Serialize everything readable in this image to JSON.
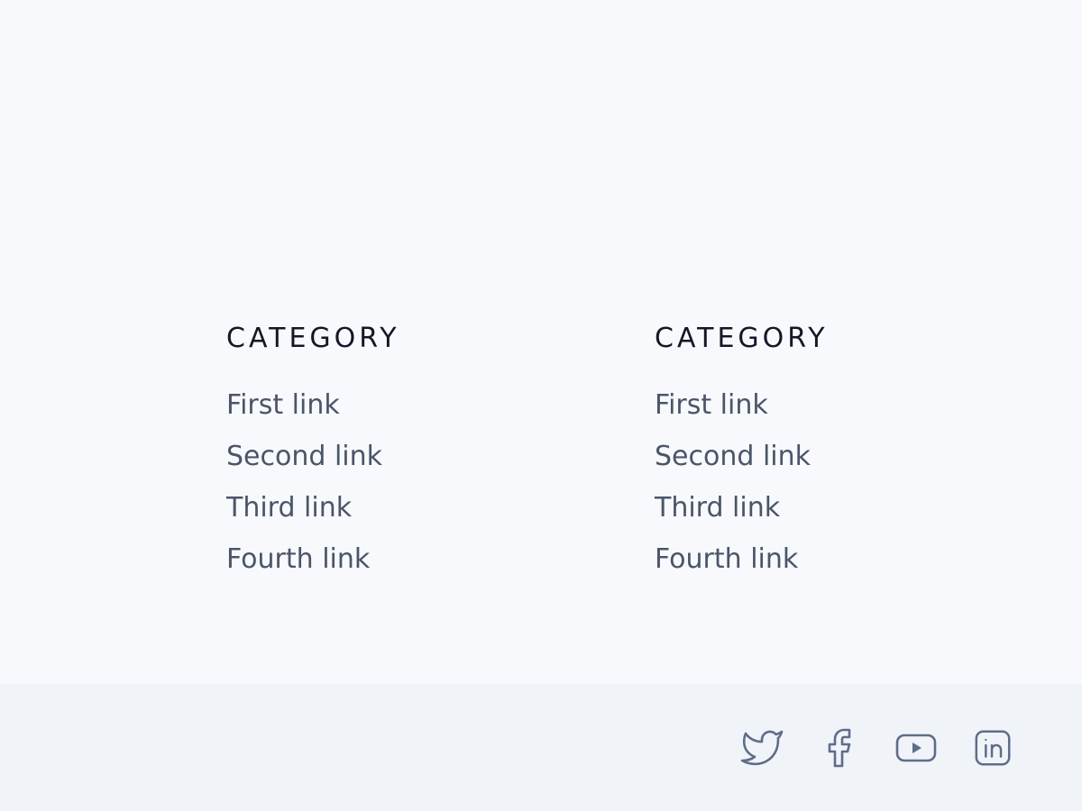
{
  "columns": [
    {
      "title": "CATEGORY",
      "links": [
        "First link",
        "Second link",
        "Third link",
        "Fourth link"
      ]
    },
    {
      "title": "CATEGORY",
      "links": [
        "First link",
        "Second link",
        "Third link",
        "Fourth link"
      ]
    }
  ],
  "social": [
    {
      "icon": "twitter-icon"
    },
    {
      "icon": "facebook-icon"
    },
    {
      "icon": "youtube-icon"
    },
    {
      "icon": "linkedin-icon"
    }
  ],
  "colors": {
    "background": "#f7f9fc",
    "footer_background": "#f0f3f8",
    "heading": "#111827",
    "link": "#4b5568",
    "icon": "#5f6d8a"
  }
}
